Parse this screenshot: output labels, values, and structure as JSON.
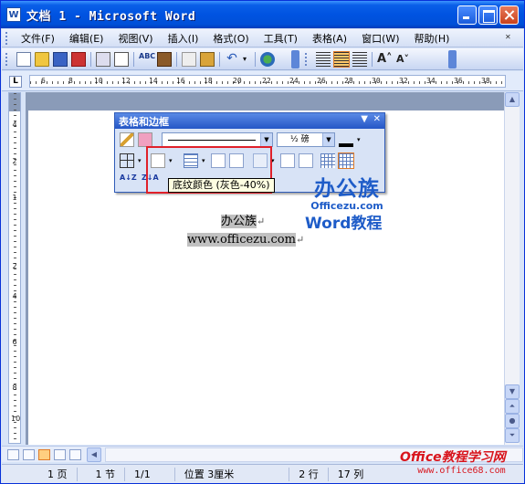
{
  "window": {
    "title": "文档 1 - Microsoft Word",
    "title_icon": "W"
  },
  "menubar": {
    "items": [
      "文件(F)",
      "编辑(E)",
      "视图(V)",
      "插入(I)",
      "格式(O)",
      "工具(T)",
      "表格(A)",
      "窗口(W)",
      "帮助(H)"
    ],
    "close_glyph": "✕"
  },
  "ruler": {
    "corner": "L",
    "h_labels": [
      "6",
      "8",
      "10",
      "12",
      "14",
      "16",
      "18",
      "20",
      "22",
      "24",
      "26",
      "28",
      "30",
      "32",
      "34",
      "36",
      "38"
    ],
    "v_labels": [
      "4",
      "2",
      "1",
      "2",
      "4",
      "6",
      "8",
      "10"
    ]
  },
  "float_toolbar": {
    "title": "表格和边框",
    "line_weight": "½ 磅",
    "sort_asc": "A↓Z",
    "sort_desc": "Z↓A",
    "tooltip": "底纹颜色 (灰色-40%)"
  },
  "document": {
    "line1": "办公族",
    "line2": "www.officezu.com",
    "para_mark": "↵"
  },
  "watermarks": {
    "logo_big": "办公族",
    "logo_small": "Officezu.com",
    "word_tutorial": "Word教程",
    "bottom_big": "Office教程学习网",
    "bottom_small": "www.office68.com"
  },
  "statusbar": {
    "page": "1 页",
    "section": "1 节",
    "page_of": "1/1",
    "position": "位置 3厘米",
    "line": "2 行",
    "column": "17 列"
  },
  "colors": {
    "title_bar": "#0053e1",
    "highlight_border": "#e0202a",
    "shading_gray": "#c0c0c0",
    "tooltip_bg": "#ffffe1",
    "watermark_blue": "#1e5cc8",
    "watermark_red": "#d8141c"
  }
}
